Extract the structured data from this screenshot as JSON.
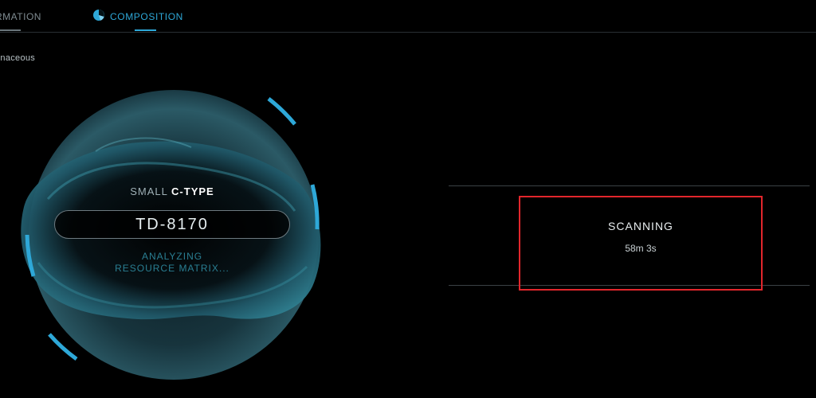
{
  "tabs": {
    "information": "RMATION",
    "composition": "COMPOSITION"
  },
  "subtype_text": "onaceous",
  "asteroid": {
    "size_word": "SMALL",
    "type_word": "C-TYPE",
    "designation": "TD-8170",
    "status_line1": "ANALYZING",
    "status_line2": "RESOURCE MATRIX..."
  },
  "scan": {
    "status": "SCANNING",
    "time_remaining": "58m 3s"
  },
  "colors": {
    "accent": "#2ea8d8",
    "highlight_box": "#e2262c",
    "background": "#000000"
  },
  "icons": {
    "composition_tab_icon": "pie-chart-icon"
  }
}
